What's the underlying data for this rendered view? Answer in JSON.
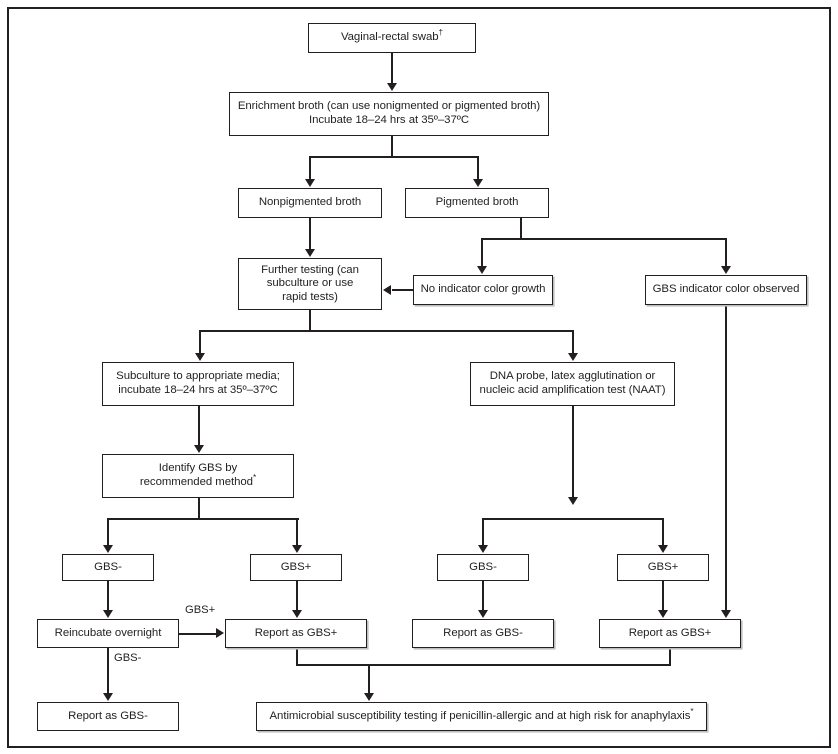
{
  "figure": {
    "type": "flowchart",
    "title": "",
    "frame_border_color": "#231f20",
    "background_color": "#ffffff",
    "nodes": [
      {
        "id": "swab",
        "label": "Vaginal-rectal swab",
        "marker": "†"
      },
      {
        "id": "enrichment",
        "line1": "Enrichment broth (can use nonigmented or pigmented broth)",
        "line2": "Incubate 18–24 hrs at  35º–37ºC"
      },
      {
        "id": "nonpigmented",
        "label": "Nonpigmented broth"
      },
      {
        "id": "pigmented",
        "label": "Pigmented broth"
      },
      {
        "id": "further_testing",
        "line1": "Further testing (can",
        "line2": "subculture or use",
        "line3": "rapid tests)"
      },
      {
        "id": "no_indicator",
        "label": "No indicator color growth"
      },
      {
        "id": "gbs_indicator",
        "label": "GBS indicator color observed"
      },
      {
        "id": "subculture",
        "line1": "Subculture to appropriate media;",
        "line2": "incubate 18–24 hrs at 35º–37ºC"
      },
      {
        "id": "dna_probe",
        "line1": "DNA probe, latex agglutination or",
        "line2": "nucleic acid amplification test (NAAT)"
      },
      {
        "id": "identify_gbs",
        "line1": "Identify GBS by",
        "line2": "recommended method",
        "marker": "*"
      },
      {
        "id": "gbs_neg_1",
        "label": "GBS-"
      },
      {
        "id": "gbs_pos_1",
        "label": "GBS+"
      },
      {
        "id": "gbs_neg_2",
        "label": "GBS-"
      },
      {
        "id": "gbs_pos_2",
        "label": "GBS+"
      },
      {
        "id": "reincubate",
        "label": "Reincubate overnight"
      },
      {
        "id": "report_pos_1",
        "label": "Report as GBS+"
      },
      {
        "id": "report_neg_2",
        "label": "Report as GBS-"
      },
      {
        "id": "report_pos_2",
        "label": "Report as GBS+"
      },
      {
        "id": "report_neg_1",
        "label": "Report as GBS-"
      },
      {
        "id": "antimicrobial",
        "label": "Antimicrobial susceptibility testing if penicillin-allergic and at high risk for anaphylaxis",
        "marker": "*"
      }
    ],
    "edge_labels": [
      {
        "id": "reincubate_pos",
        "label": "GBS+"
      },
      {
        "id": "reincubate_neg",
        "label": "GBS-"
      }
    ]
  }
}
